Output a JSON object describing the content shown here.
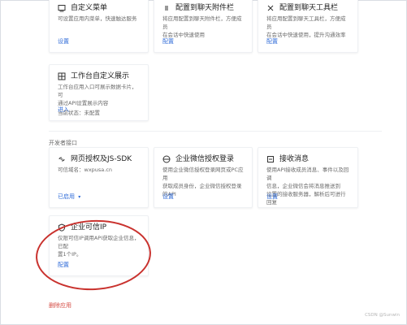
{
  "cards_top": [
    {
      "title": "自定义菜单",
      "desc": "可设置应用内菜单，快速触达服务",
      "action": "设置",
      "icon": "menu-icon"
    },
    {
      "title": "配置到聊天附件栏",
      "desc": "将应用配置到聊天附件栏，方便成员\n在会话中快速使用",
      "action": "配置",
      "icon": "attachment-icon"
    },
    {
      "title": "配置到聊天工具栏",
      "desc": "将应用配置到聊天工具栏，方便成员\n在会话中快速使用，提升沟通效率",
      "action": "配置",
      "icon": "tool-icon"
    }
  ],
  "card_workspace": {
    "title": "工作台自定义展示",
    "desc": "工作台应用入口可展示数据卡片，可\n通过API设置展示内容",
    "status": "当前状态：未配置",
    "action": "进入",
    "icon": "grid-icon"
  },
  "section_dev": {
    "label": "开发者接口"
  },
  "cards_dev": [
    {
      "title": "网页授权及JS-SDK",
      "desc": "可信域名：wxpusa.cn",
      "action": "已启用",
      "icon": "link-icon",
      "has_chevron": true
    },
    {
      "title": "企业微信授权登录",
      "desc": "使用企业微信授权登录网页或PC应用\n获取成员身份，企业微信授权登录\n的API",
      "action": "设置",
      "icon": "globe-icon"
    },
    {
      "title": "接收消息",
      "desc": "使用API接收成员消息、事件以及回调\n信息，企业微信会将消息推送到\n设置的接收服务器，解析后可进行回复",
      "action": "设置",
      "icon": "inbox-icon"
    }
  ],
  "card_ip": {
    "title": "企业可信IP",
    "desc": "仅限可信IP调用API获取企业信息，已配\n置1个IP。",
    "action": "配置",
    "icon": "shield-icon"
  },
  "bottom_link": "删除应用",
  "watermark": "CSDN @Sunwin"
}
